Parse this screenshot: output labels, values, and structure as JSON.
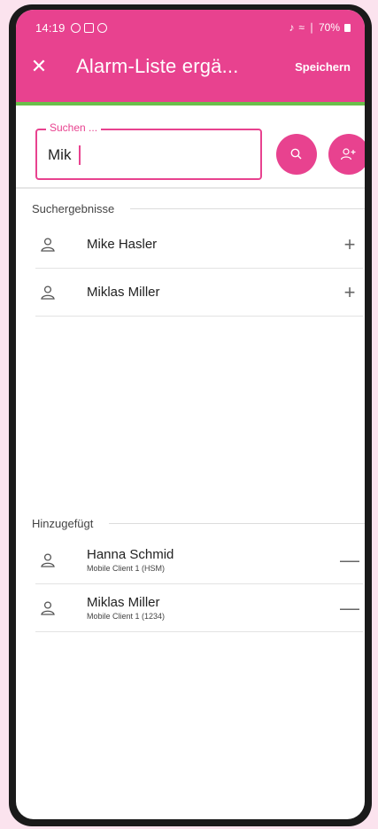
{
  "status": {
    "time": "14:19",
    "battery": "70%"
  },
  "appbar": {
    "title": "Alarm-Liste ergä...",
    "save_label": "Speichern",
    "close_glyph": "✕"
  },
  "search": {
    "legend": "Suchen ...",
    "value": "Mik"
  },
  "results": {
    "header": "Suchergebnisse",
    "items": [
      {
        "name": "Mike Hasler",
        "action": "+"
      },
      {
        "name": "Miklas Miller",
        "action": "+"
      }
    ]
  },
  "added": {
    "header": "Hinzugefügt",
    "items": [
      {
        "name": "Hanna Schmid",
        "sub": "Mobile Client 1 (HSM)",
        "action": "—"
      },
      {
        "name": "Miklas Miller",
        "sub": "Mobile Client 1 (1234)",
        "action": "—"
      }
    ]
  },
  "colors": {
    "accent": "#e8428f",
    "appbar_bottom": "#6ac04b",
    "background": "#fbe3ee"
  },
  "icons": {
    "search_button": "search-icon",
    "add_person_button": "person-add-icon",
    "person": "person-icon"
  }
}
